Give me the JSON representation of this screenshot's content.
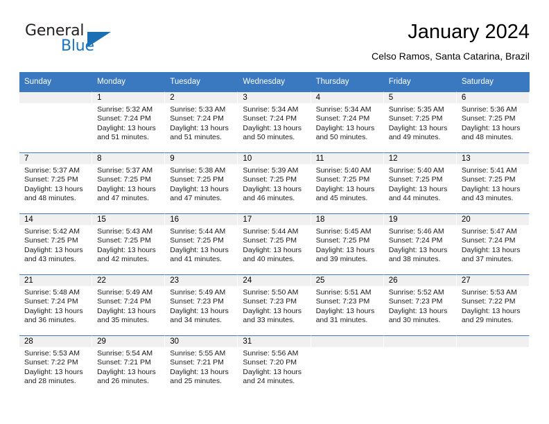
{
  "brand": {
    "name_part1": "General",
    "name_part2": "Blue",
    "accent_color": "#1b75bb"
  },
  "header": {
    "title": "January 2024",
    "subtitle": "Celso Ramos, Santa Catarina, Brazil"
  },
  "theme": {
    "header_row_bg": "#3a79bf",
    "daynum_band_bg": "#f0f0f0",
    "text_color": "#000000"
  },
  "weekday_headers": [
    "Sunday",
    "Monday",
    "Tuesday",
    "Wednesday",
    "Thursday",
    "Friday",
    "Saturday"
  ],
  "labels": {
    "sunrise_prefix": "Sunrise:",
    "sunset_prefix": "Sunset:",
    "daylight_prefix": "Daylight:"
  },
  "weeks": [
    [
      {
        "day": "",
        "sunrise": "",
        "sunset": "",
        "daylight_line1": "",
        "daylight_line2": "",
        "empty": true
      },
      {
        "day": "1",
        "sunrise": "Sunrise: 5:32 AM",
        "sunset": "Sunset: 7:24 PM",
        "daylight_line1": "Daylight: 13 hours",
        "daylight_line2": "and 51 minutes.",
        "empty": false
      },
      {
        "day": "2",
        "sunrise": "Sunrise: 5:33 AM",
        "sunset": "Sunset: 7:24 PM",
        "daylight_line1": "Daylight: 13 hours",
        "daylight_line2": "and 51 minutes.",
        "empty": false
      },
      {
        "day": "3",
        "sunrise": "Sunrise: 5:34 AM",
        "sunset": "Sunset: 7:24 PM",
        "daylight_line1": "Daylight: 13 hours",
        "daylight_line2": "and 50 minutes.",
        "empty": false
      },
      {
        "day": "4",
        "sunrise": "Sunrise: 5:34 AM",
        "sunset": "Sunset: 7:24 PM",
        "daylight_line1": "Daylight: 13 hours",
        "daylight_line2": "and 50 minutes.",
        "empty": false
      },
      {
        "day": "5",
        "sunrise": "Sunrise: 5:35 AM",
        "sunset": "Sunset: 7:25 PM",
        "daylight_line1": "Daylight: 13 hours",
        "daylight_line2": "and 49 minutes.",
        "empty": false
      },
      {
        "day": "6",
        "sunrise": "Sunrise: 5:36 AM",
        "sunset": "Sunset: 7:25 PM",
        "daylight_line1": "Daylight: 13 hours",
        "daylight_line2": "and 48 minutes.",
        "empty": false
      }
    ],
    [
      {
        "day": "7",
        "sunrise": "Sunrise: 5:37 AM",
        "sunset": "Sunset: 7:25 PM",
        "daylight_line1": "Daylight: 13 hours",
        "daylight_line2": "and 48 minutes.",
        "empty": false
      },
      {
        "day": "8",
        "sunrise": "Sunrise: 5:37 AM",
        "sunset": "Sunset: 7:25 PM",
        "daylight_line1": "Daylight: 13 hours",
        "daylight_line2": "and 47 minutes.",
        "empty": false
      },
      {
        "day": "9",
        "sunrise": "Sunrise: 5:38 AM",
        "sunset": "Sunset: 7:25 PM",
        "daylight_line1": "Daylight: 13 hours",
        "daylight_line2": "and 47 minutes.",
        "empty": false
      },
      {
        "day": "10",
        "sunrise": "Sunrise: 5:39 AM",
        "sunset": "Sunset: 7:25 PM",
        "daylight_line1": "Daylight: 13 hours",
        "daylight_line2": "and 46 minutes.",
        "empty": false
      },
      {
        "day": "11",
        "sunrise": "Sunrise: 5:40 AM",
        "sunset": "Sunset: 7:25 PM",
        "daylight_line1": "Daylight: 13 hours",
        "daylight_line2": "and 45 minutes.",
        "empty": false
      },
      {
        "day": "12",
        "sunrise": "Sunrise: 5:40 AM",
        "sunset": "Sunset: 7:25 PM",
        "daylight_line1": "Daylight: 13 hours",
        "daylight_line2": "and 44 minutes.",
        "empty": false
      },
      {
        "day": "13",
        "sunrise": "Sunrise: 5:41 AM",
        "sunset": "Sunset: 7:25 PM",
        "daylight_line1": "Daylight: 13 hours",
        "daylight_line2": "and 43 minutes.",
        "empty": false
      }
    ],
    [
      {
        "day": "14",
        "sunrise": "Sunrise: 5:42 AM",
        "sunset": "Sunset: 7:25 PM",
        "daylight_line1": "Daylight: 13 hours",
        "daylight_line2": "and 43 minutes.",
        "empty": false
      },
      {
        "day": "15",
        "sunrise": "Sunrise: 5:43 AM",
        "sunset": "Sunset: 7:25 PM",
        "daylight_line1": "Daylight: 13 hours",
        "daylight_line2": "and 42 minutes.",
        "empty": false
      },
      {
        "day": "16",
        "sunrise": "Sunrise: 5:44 AM",
        "sunset": "Sunset: 7:25 PM",
        "daylight_line1": "Daylight: 13 hours",
        "daylight_line2": "and 41 minutes.",
        "empty": false
      },
      {
        "day": "17",
        "sunrise": "Sunrise: 5:44 AM",
        "sunset": "Sunset: 7:25 PM",
        "daylight_line1": "Daylight: 13 hours",
        "daylight_line2": "and 40 minutes.",
        "empty": false
      },
      {
        "day": "18",
        "sunrise": "Sunrise: 5:45 AM",
        "sunset": "Sunset: 7:25 PM",
        "daylight_line1": "Daylight: 13 hours",
        "daylight_line2": "and 39 minutes.",
        "empty": false
      },
      {
        "day": "19",
        "sunrise": "Sunrise: 5:46 AM",
        "sunset": "Sunset: 7:24 PM",
        "daylight_line1": "Daylight: 13 hours",
        "daylight_line2": "and 38 minutes.",
        "empty": false
      },
      {
        "day": "20",
        "sunrise": "Sunrise: 5:47 AM",
        "sunset": "Sunset: 7:24 PM",
        "daylight_line1": "Daylight: 13 hours",
        "daylight_line2": "and 37 minutes.",
        "empty": false
      }
    ],
    [
      {
        "day": "21",
        "sunrise": "Sunrise: 5:48 AM",
        "sunset": "Sunset: 7:24 PM",
        "daylight_line1": "Daylight: 13 hours",
        "daylight_line2": "and 36 minutes.",
        "empty": false
      },
      {
        "day": "22",
        "sunrise": "Sunrise: 5:49 AM",
        "sunset": "Sunset: 7:24 PM",
        "daylight_line1": "Daylight: 13 hours",
        "daylight_line2": "and 35 minutes.",
        "empty": false
      },
      {
        "day": "23",
        "sunrise": "Sunrise: 5:49 AM",
        "sunset": "Sunset: 7:23 PM",
        "daylight_line1": "Daylight: 13 hours",
        "daylight_line2": "and 34 minutes.",
        "empty": false
      },
      {
        "day": "24",
        "sunrise": "Sunrise: 5:50 AM",
        "sunset": "Sunset: 7:23 PM",
        "daylight_line1": "Daylight: 13 hours",
        "daylight_line2": "and 33 minutes.",
        "empty": false
      },
      {
        "day": "25",
        "sunrise": "Sunrise: 5:51 AM",
        "sunset": "Sunset: 7:23 PM",
        "daylight_line1": "Daylight: 13 hours",
        "daylight_line2": "and 31 minutes.",
        "empty": false
      },
      {
        "day": "26",
        "sunrise": "Sunrise: 5:52 AM",
        "sunset": "Sunset: 7:23 PM",
        "daylight_line1": "Daylight: 13 hours",
        "daylight_line2": "and 30 minutes.",
        "empty": false
      },
      {
        "day": "27",
        "sunrise": "Sunrise: 5:53 AM",
        "sunset": "Sunset: 7:22 PM",
        "daylight_line1": "Daylight: 13 hours",
        "daylight_line2": "and 29 minutes.",
        "empty": false
      }
    ],
    [
      {
        "day": "28",
        "sunrise": "Sunrise: 5:53 AM",
        "sunset": "Sunset: 7:22 PM",
        "daylight_line1": "Daylight: 13 hours",
        "daylight_line2": "and 28 minutes.",
        "empty": false
      },
      {
        "day": "29",
        "sunrise": "Sunrise: 5:54 AM",
        "sunset": "Sunset: 7:21 PM",
        "daylight_line1": "Daylight: 13 hours",
        "daylight_line2": "and 26 minutes.",
        "empty": false
      },
      {
        "day": "30",
        "sunrise": "Sunrise: 5:55 AM",
        "sunset": "Sunset: 7:21 PM",
        "daylight_line1": "Daylight: 13 hours",
        "daylight_line2": "and 25 minutes.",
        "empty": false
      },
      {
        "day": "31",
        "sunrise": "Sunrise: 5:56 AM",
        "sunset": "Sunset: 7:20 PM",
        "daylight_line1": "Daylight: 13 hours",
        "daylight_line2": "and 24 minutes.",
        "empty": false
      },
      {
        "day": "",
        "sunrise": "",
        "sunset": "",
        "daylight_line1": "",
        "daylight_line2": "",
        "empty": true
      },
      {
        "day": "",
        "sunrise": "",
        "sunset": "",
        "daylight_line1": "",
        "daylight_line2": "",
        "empty": true
      },
      {
        "day": "",
        "sunrise": "",
        "sunset": "",
        "daylight_line1": "",
        "daylight_line2": "",
        "empty": true
      }
    ]
  ]
}
